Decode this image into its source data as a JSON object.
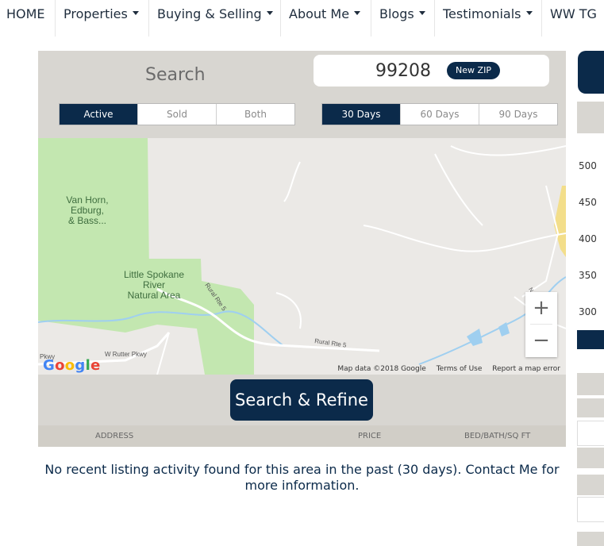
{
  "nav": {
    "items": [
      {
        "label": "HOME",
        "dropdown": false
      },
      {
        "label": "Properties",
        "dropdown": true
      },
      {
        "label": "Buying & Selling",
        "dropdown": true
      },
      {
        "label": "About Me",
        "dropdown": true
      },
      {
        "label": "Blogs",
        "dropdown": true
      },
      {
        "label": "Testimonials",
        "dropdown": true
      },
      {
        "label": "WW TG",
        "dropdown": false
      }
    ]
  },
  "search": {
    "label": "Search",
    "zip": "99208",
    "new_zip_label": "New ZIP"
  },
  "status_filter": {
    "options": [
      "Active",
      "Sold",
      "Both"
    ],
    "selected": "Active"
  },
  "days_filter": {
    "options": [
      "30 Days",
      "60 Days",
      "90 Days"
    ],
    "selected": "30 Days"
  },
  "map": {
    "labels": {
      "park1": "Van Horn, Edburg, & Bass...",
      "park2": "Little Spokane River Natural Area",
      "road1": "Rural Rte 5",
      "road2": "Rural Rte 5",
      "road3": "W Rutter Pkwy",
      "road4": "Pkwy",
      "road5": "N Mill Rd"
    },
    "zoom_in": "+",
    "zoom_out": "−",
    "google_logo": "Google",
    "attribution": {
      "map_data": "Map data ©2018 Google",
      "terms": "Terms of Use",
      "report": "Report a map error"
    }
  },
  "refine_button": "Search & Refine",
  "table": {
    "headers": [
      "ADDRESS",
      "PRICE",
      "BED/BATH/SQ FT"
    ]
  },
  "message": "No recent listing activity found for this area in the past (30 days). Contact Me for more information.",
  "right_panel": {
    "y_ticks": [
      "500",
      "450",
      "400",
      "350",
      "300"
    ]
  },
  "colors": {
    "navy": "#0b2a4a",
    "park_green": "#c3e7b0",
    "panel_gray": "#d8d6d1",
    "water": "#9fcff0"
  }
}
